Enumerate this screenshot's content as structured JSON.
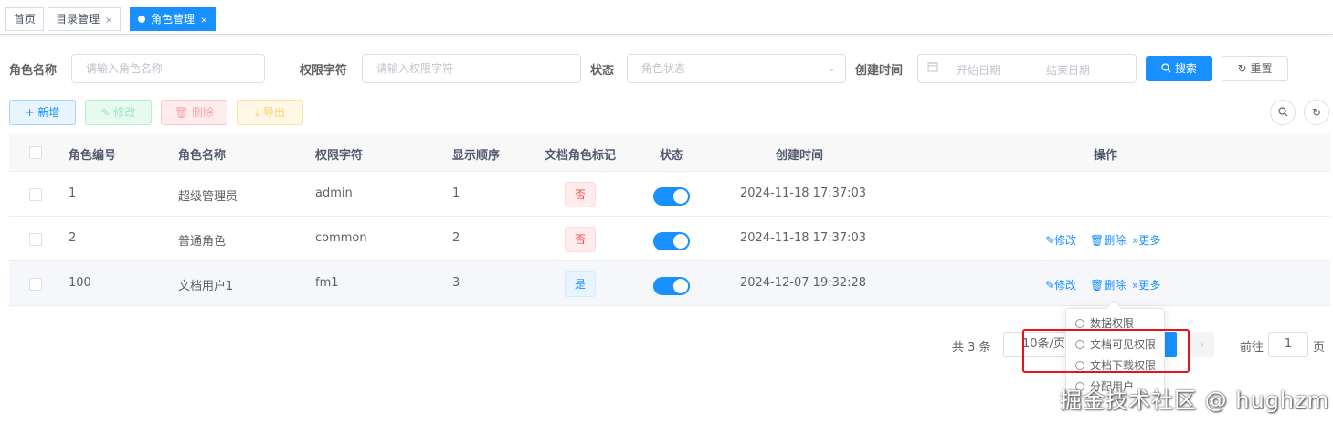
{
  "tags": {
    "home": "首页",
    "catalog": "目录管理",
    "role": "角色管理",
    "close": "×"
  },
  "search": {
    "role_name_label": "角色名称",
    "role_name_placeholder": "请输入角色名称",
    "perm_label": "权限字符",
    "perm_placeholder": "请输入权限字符",
    "status_label": "状态",
    "status_placeholder": "角色状态",
    "created_label": "创建时间",
    "start_placeholder": "开始日期",
    "range_sep": "-",
    "end_placeholder": "结束日期",
    "search_btn": "搜索",
    "reset_btn": "重置"
  },
  "toolbar": {
    "add": "新增",
    "edit": "修改",
    "delete": "删除",
    "export": "导出"
  },
  "table": {
    "headers": [
      "角色编号",
      "角色名称",
      "权限字符",
      "显示顺序",
      "文档角色标记",
      "状态",
      "创建时间",
      "操作"
    ],
    "rows": [
      {
        "id": "1",
        "name": "超级管理员",
        "key": "admin",
        "sort": "1",
        "doc_flag": "否",
        "status_on": true,
        "created": "2024-11-18 17:37:03",
        "has_ops": false
      },
      {
        "id": "2",
        "name": "普通角色",
        "key": "common",
        "sort": "2",
        "doc_flag": "否",
        "status_on": true,
        "created": "2024-11-18 17:37:03",
        "has_ops": true
      },
      {
        "id": "100",
        "name": "文档用户1",
        "key": "fm1",
        "sort": "3",
        "doc_flag": "是",
        "status_on": true,
        "created": "2024-12-07 19:32:28",
        "has_ops": true
      }
    ],
    "ops": {
      "edit": "修改",
      "delete": "删除",
      "more": "更多"
    }
  },
  "pagination": {
    "total": "共 3 条",
    "page_size": "10条/页",
    "goto": "前往",
    "page_value": "1",
    "page_unit": "页"
  },
  "dropdown": {
    "items": [
      "数据权限",
      "文档可见权限",
      "文档下载权限",
      "分配用户"
    ]
  },
  "watermark": "掘金技术社区 @ hughzm",
  "colors": {
    "primary": "#1890ff",
    "danger": "#ff4949",
    "highlight": "#e4141b"
  }
}
